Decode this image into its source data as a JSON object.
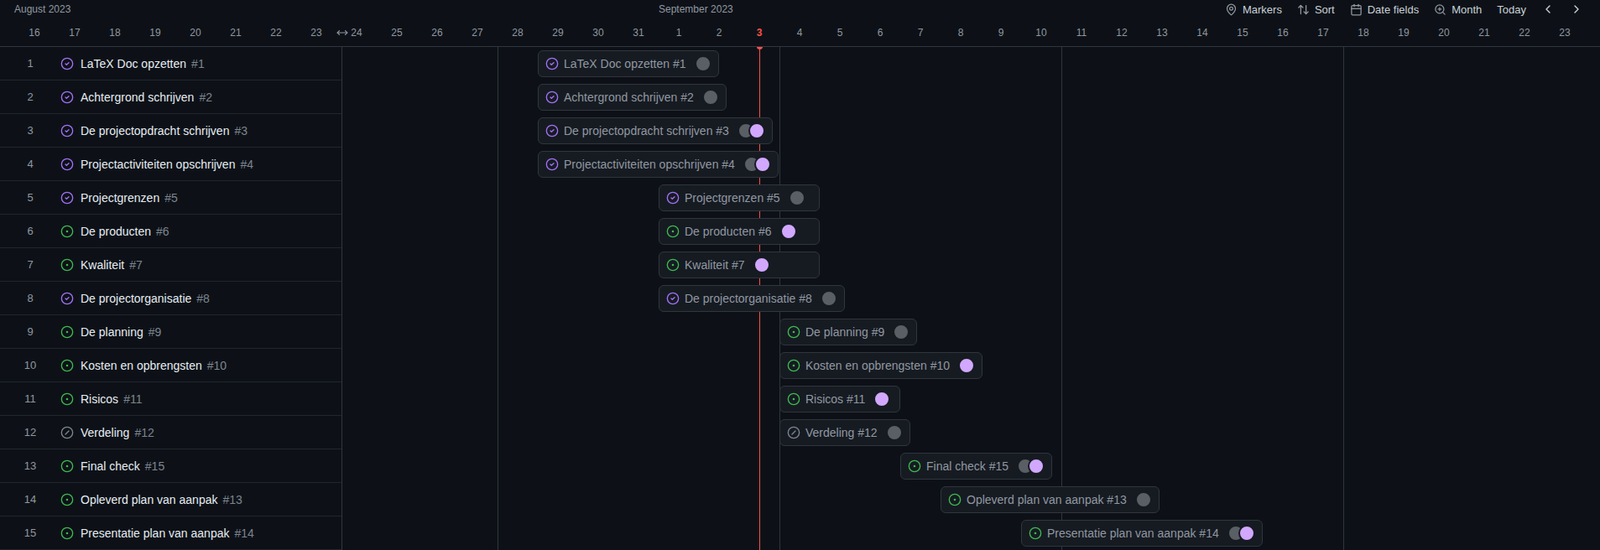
{
  "toolbar": [
    {
      "kind": "markers",
      "label": "Markers"
    },
    {
      "kind": "sort",
      "label": "Sort"
    },
    {
      "kind": "date",
      "label": "Date fields"
    },
    {
      "kind": "zoom",
      "label": "Month"
    },
    {
      "kind": "text",
      "label": "Today"
    }
  ],
  "months": [
    {
      "label": "August 2023",
      "days": [
        "16",
        "17",
        "18",
        "19",
        "20",
        "21",
        "22",
        "23",
        "24",
        "25",
        "26",
        "27",
        "28",
        "29",
        "30",
        "31"
      ]
    },
    {
      "label": "September 2023",
      "days": [
        "1",
        "2",
        "3",
        "4",
        "5",
        "6",
        "7",
        "8",
        "9",
        "10",
        "11",
        "12",
        "13",
        "14",
        "15",
        "16",
        "17",
        "18",
        "19",
        "20",
        "21",
        "22",
        "23"
      ]
    }
  ],
  "today": {
    "month": "September 2023",
    "day": "3"
  },
  "items": [
    {
      "number": "1",
      "title": "LaTeX Doc opzetten",
      "ref": "#1",
      "status": "done",
      "start": 13,
      "days": 1,
      "assignees": [
        {
          "color": "#5a5f66"
        }
      ]
    },
    {
      "number": "2",
      "title": "Achtergrond schrijven",
      "ref": "#2",
      "status": "done",
      "start": 13,
      "days": 1,
      "assignees": [
        {
          "color": "#5a5f66"
        }
      ]
    },
    {
      "number": "3",
      "title": "De projectopdracht schrijven",
      "ref": "#3",
      "status": "done",
      "start": 13,
      "days": 3,
      "assignees": [
        {
          "color": "#5a5f66"
        },
        {
          "color": "#d2a8ff"
        }
      ]
    },
    {
      "number": "4",
      "title": "Projectactiviteiten opschrijven",
      "ref": "#4",
      "status": "done",
      "start": 13,
      "days": 3,
      "assignees": [
        {
          "color": "#5a5f66"
        },
        {
          "color": "#d2a8ff"
        }
      ]
    },
    {
      "number": "5",
      "title": "Projectgrenzen",
      "ref": "#5",
      "status": "done",
      "start": 16,
      "days": 4,
      "assignees": [
        {
          "color": "#5a5f66"
        }
      ]
    },
    {
      "number": "6",
      "title": "De producten",
      "ref": "#6",
      "status": "open",
      "start": 16,
      "days": 4,
      "assignees": [
        {
          "color": "#d2a8ff"
        }
      ]
    },
    {
      "number": "7",
      "title": "Kwaliteit",
      "ref": "#7",
      "status": "open",
      "start": 16,
      "days": 4,
      "assignees": [
        {
          "color": "#d2a8ff"
        }
      ]
    },
    {
      "number": "8",
      "title": "De projectorganisatie",
      "ref": "#8",
      "status": "done",
      "start": 16,
      "days": 4,
      "assignees": [
        {
          "color": "#5a5f66"
        }
      ]
    },
    {
      "number": "9",
      "title": "De planning",
      "ref": "#9",
      "status": "open",
      "start": 19,
      "days": 3,
      "assignees": [
        {
          "color": "#5a5f66"
        }
      ]
    },
    {
      "number": "10",
      "title": "Kosten en opbrengsten",
      "ref": "#10",
      "status": "open",
      "start": 19,
      "days": 3,
      "assignees": [
        {
          "color": "#d2a8ff"
        }
      ]
    },
    {
      "number": "11",
      "title": "Risicos",
      "ref": "#11",
      "status": "open",
      "start": 19,
      "days": 3,
      "assignees": [
        {
          "color": "#d2a8ff"
        }
      ]
    },
    {
      "number": "12",
      "title": "Verdeling",
      "ref": "#12",
      "status": "not_planned",
      "start": 19,
      "days": 3,
      "assignees": [
        {
          "color": "#5a5f66"
        }
      ]
    },
    {
      "number": "13",
      "title": "Final check",
      "ref": "#15",
      "status": "open",
      "start": 22,
      "days": 1,
      "assignees": [
        {
          "color": "#5a5f66"
        },
        {
          "color": "#d2a8ff"
        }
      ]
    },
    {
      "number": "14",
      "title": "Opleverd plan van aanpak",
      "ref": "#13",
      "status": "open",
      "start": 23,
      "days": 1,
      "assignees": [
        {
          "color": "#5a5f66"
        }
      ]
    },
    {
      "number": "15",
      "title": "Presentatie plan van aanpak",
      "ref": "#14",
      "status": "open",
      "start": 25,
      "days": 6,
      "assignees": [
        {
          "color": "#5a5f66"
        },
        {
          "color": "#d2a8ff"
        }
      ]
    }
  ]
}
